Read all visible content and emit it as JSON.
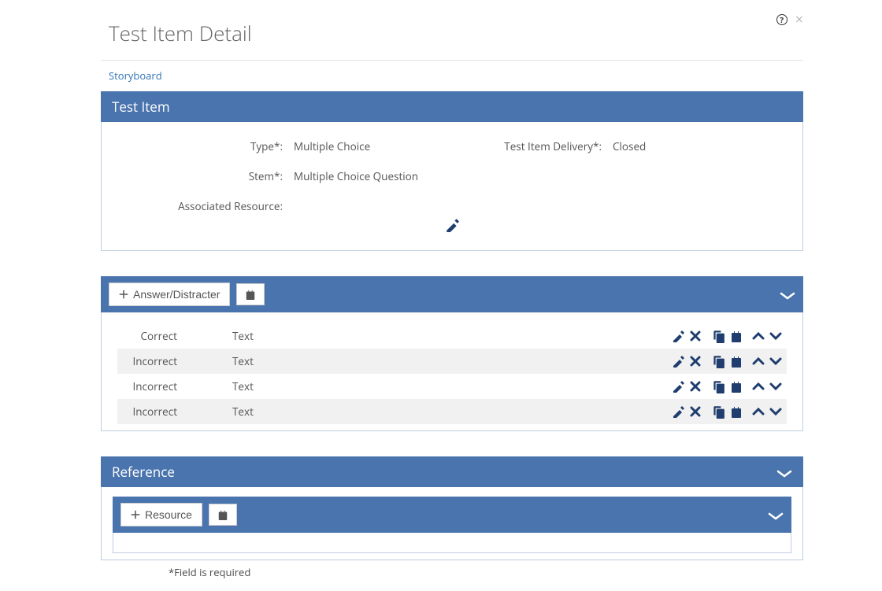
{
  "header": {
    "title": "Test Item Detail"
  },
  "tabs": {
    "storyboard": "Storyboard"
  },
  "testItem": {
    "panelTitle": "Test Item",
    "labels": {
      "type": "Type*:",
      "delivery": "Test Item Delivery*:",
      "stem": "Stem*:",
      "associatedResource": "Associated Resource:"
    },
    "values": {
      "type": "Multiple Choice",
      "delivery": "Closed",
      "stem": "Multiple Choice Question",
      "associatedResource": ""
    }
  },
  "answers": {
    "addButton": "Answer/Distracter",
    "rows": [
      {
        "label": "Correct",
        "text": "Text"
      },
      {
        "label": "Incorrect",
        "text": "Text"
      },
      {
        "label": "Incorrect",
        "text": "Text"
      },
      {
        "label": "Incorrect",
        "text": "Text"
      }
    ]
  },
  "reference": {
    "panelTitle": "Reference",
    "addButton": "Resource"
  },
  "footnote": "*Field is required"
}
